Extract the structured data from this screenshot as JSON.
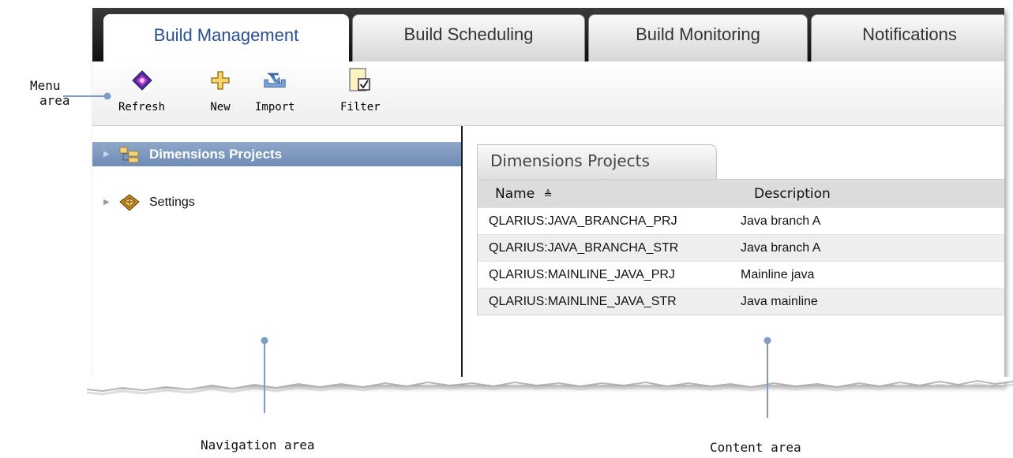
{
  "tabs": [
    {
      "label": "Build Management",
      "active": true
    },
    {
      "label": "Build Scheduling",
      "active": false
    },
    {
      "label": "Build Monitoring",
      "active": false
    },
    {
      "label": "Notifications",
      "active": false
    }
  ],
  "toolbar": {
    "refresh_label": "Refresh",
    "new_label": "New",
    "import_label": "Import",
    "filter_label": "Filter"
  },
  "nav": {
    "items": [
      {
        "label": "Dimensions Projects",
        "icon": "project-folder-icon",
        "selected": true
      },
      {
        "label": "Settings",
        "icon": "settings-icon",
        "selected": false
      }
    ]
  },
  "content": {
    "tab_label": "Dimensions Projects",
    "columns": [
      "Name",
      "Description"
    ],
    "sort_indicator": "≜",
    "rows": [
      {
        "name": "QLARIUS:JAVA_BRANCHA_PRJ",
        "description": "Java branch A"
      },
      {
        "name": "QLARIUS:JAVA_BRANCHA_STR",
        "description": "Java branch A"
      },
      {
        "name": "QLARIUS:MAINLINE_JAVA_PRJ",
        "description": "Mainline java"
      },
      {
        "name": "QLARIUS:MAINLINE_JAVA_STR",
        "description": "Java mainline"
      }
    ]
  },
  "callouts": {
    "menu_line1": "Menu",
    "menu_line2": "area",
    "navigation": "Navigation area",
    "content": "Content area"
  },
  "colors": {
    "accent": "#2b4f8c",
    "selection": "#7d98bf",
    "callout_line": "#7f9cc6"
  }
}
